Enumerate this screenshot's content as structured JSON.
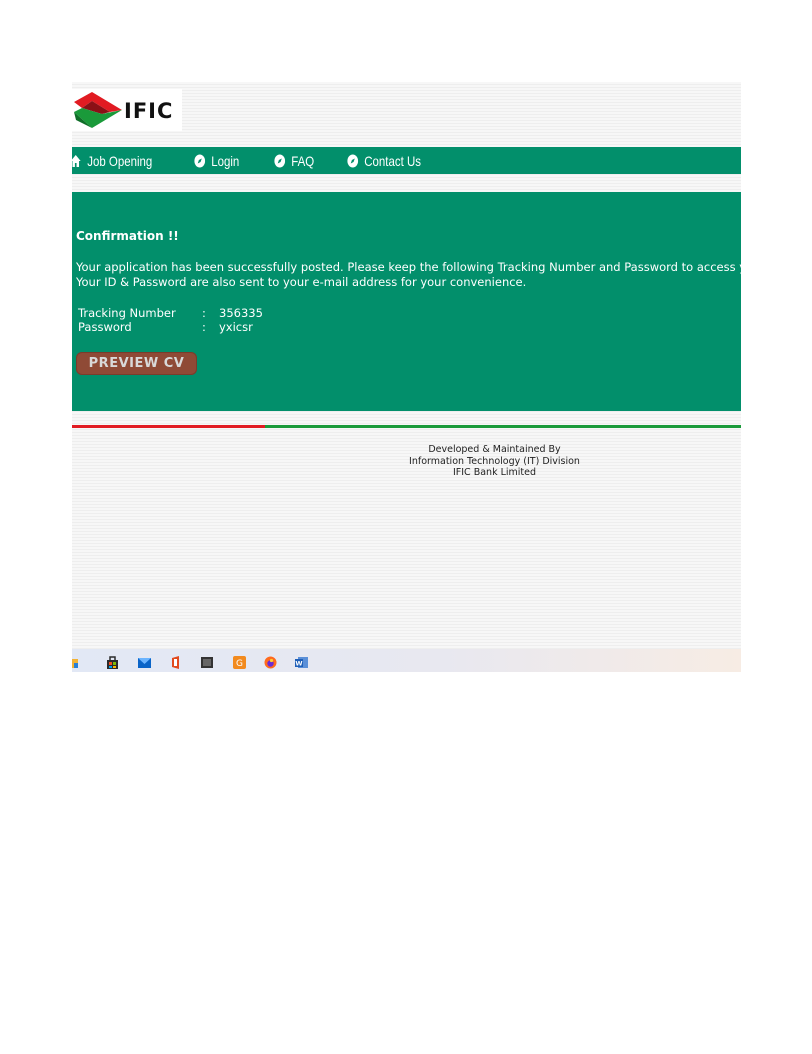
{
  "header": {
    "logo_text": "IFIC"
  },
  "nav": {
    "items": [
      {
        "label": "Job Opening",
        "icon": "home-icon"
      },
      {
        "label": "Login",
        "icon": "compass-icon"
      },
      {
        "label": "FAQ",
        "icon": "compass-icon"
      },
      {
        "label": "Contact Us",
        "icon": "compass-icon"
      }
    ]
  },
  "confirmation": {
    "title": "Confirmation !!",
    "message_line1": "Your application has been successfully posted. Please keep the following Tracking Number and Password to access your profile,",
    "message_line2": "Your ID & Password are also sent to your e-mail address for your convenience.",
    "tracking_label": "Tracking Number",
    "tracking_sep": ":",
    "tracking_value": "356335",
    "password_label": "Password",
    "password_sep": ":",
    "password_value": "yxicsr",
    "preview_button": "PREVIEW CV"
  },
  "footer": {
    "line1": "Developed & Maintained By",
    "line2": "Information Technology (IT) Division",
    "line3": "IFIC Bank Limited"
  },
  "taskbar": {
    "icons": [
      "file-explorer-icon",
      "store-icon",
      "mail-icon",
      "office-icon",
      "terminal-icon",
      "app-icon",
      "firefox-icon",
      "word-icon"
    ]
  },
  "colors": {
    "brand_green": "#028f6b",
    "button_brown": "#8f4a36",
    "divider_red": "#e11b22",
    "divider_green": "#1a9a3a"
  }
}
